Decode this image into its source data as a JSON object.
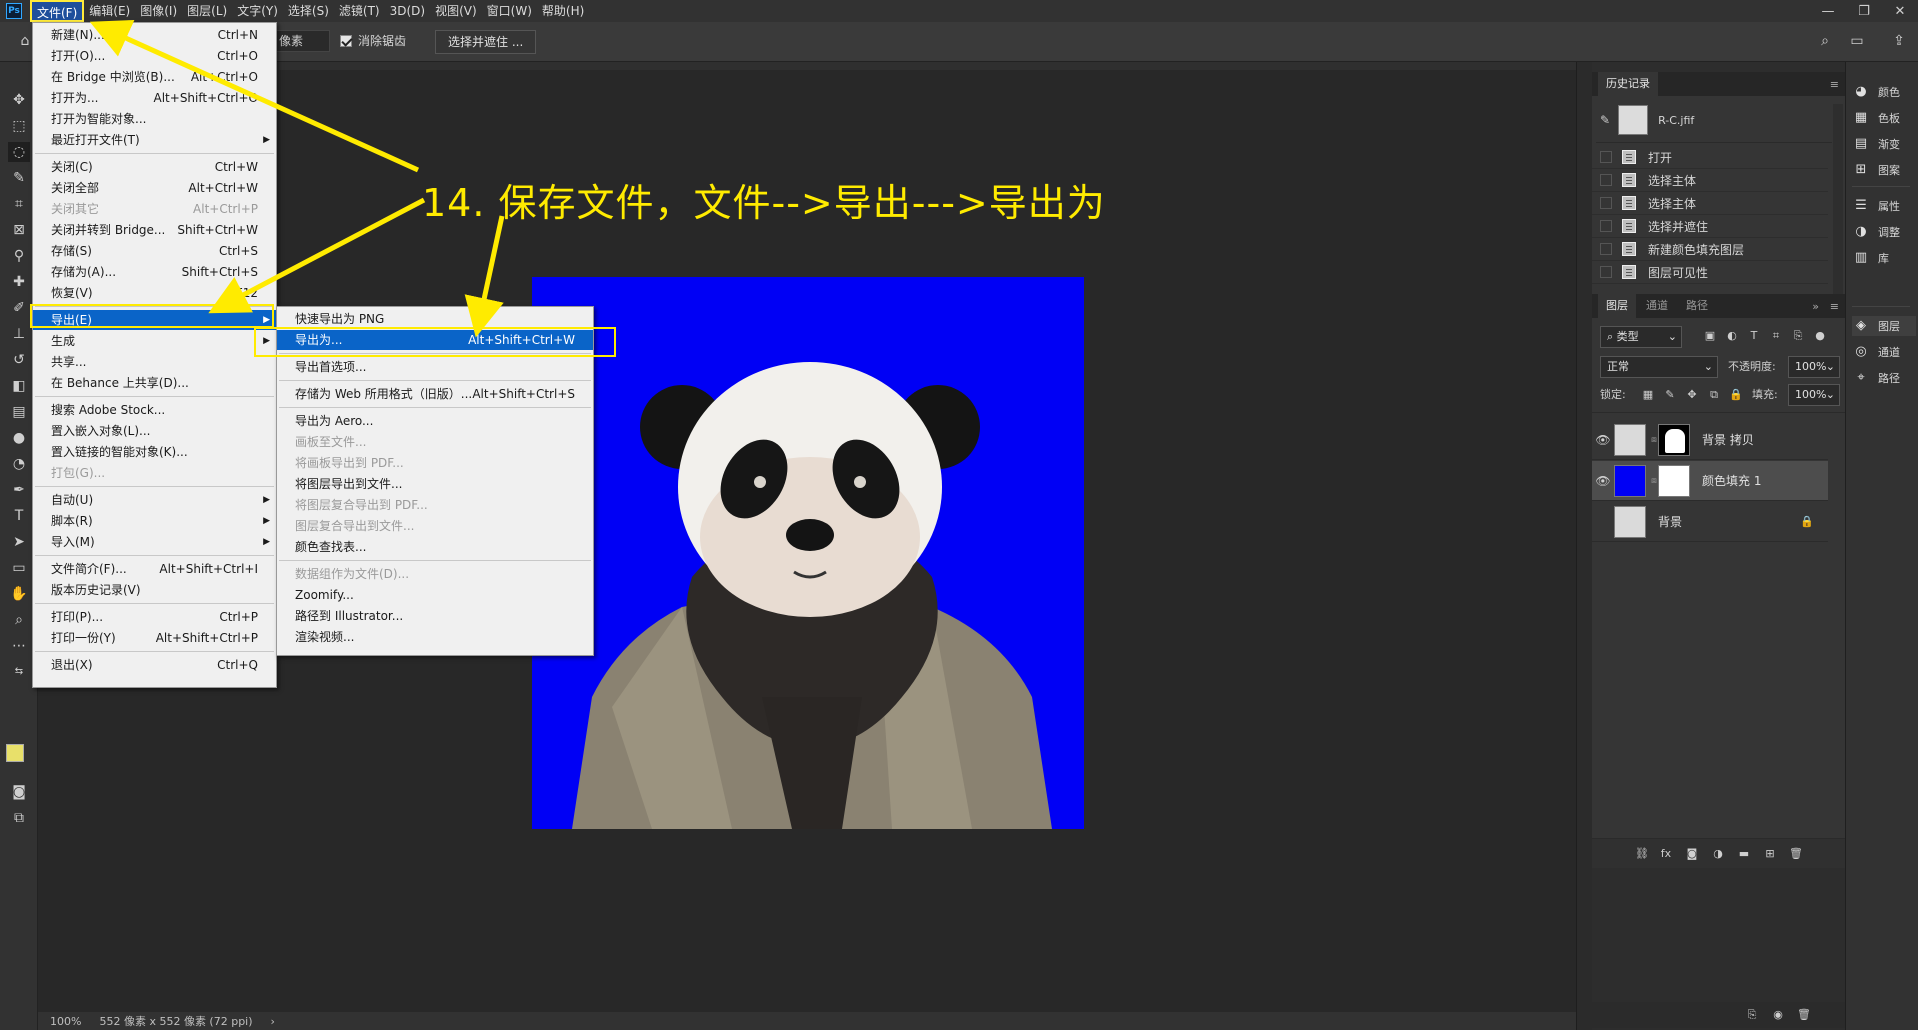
{
  "app": {
    "logo": "Ps"
  },
  "menubar": {
    "items": [
      "文件(F)",
      "编辑(E)",
      "图像(I)",
      "图层(L)",
      "文字(Y)",
      "选择(S)",
      "滤镜(T)",
      "3D(D)",
      "视图(V)",
      "窗口(W)",
      "帮助(H)"
    ],
    "window_controls": [
      "—",
      "❐",
      "✕"
    ]
  },
  "options": {
    "feather_unit": "像素",
    "antialias_label": "消除锯齿",
    "select_mask_button": "选择并遮住 ..."
  },
  "file_menu": {
    "items": [
      {
        "label": "新建(N)...",
        "shortcut": "Ctrl+N"
      },
      {
        "label": "打开(O)...",
        "shortcut": "Ctrl+O"
      },
      {
        "label": "在 Bridge 中浏览(B)...",
        "shortcut": "Alt+Ctrl+O"
      },
      {
        "label": "打开为...",
        "shortcut": "Alt+Shift+Ctrl+O"
      },
      {
        "label": "打开为智能对象...",
        "shortcut": ""
      },
      {
        "label": "最近打开文件(T)",
        "shortcut": ""
      },
      {
        "label": "关闭(C)",
        "shortcut": "Ctrl+W"
      },
      {
        "label": "关闭全部",
        "shortcut": "Alt+Ctrl+W"
      },
      {
        "label": "关闭其它",
        "shortcut": "Alt+Ctrl+P"
      },
      {
        "label": "关闭并转到 Bridge...",
        "shortcut": "Shift+Ctrl+W"
      },
      {
        "label": "存储(S)",
        "shortcut": "Ctrl+S"
      },
      {
        "label": "存储为(A)...",
        "shortcut": "Shift+Ctrl+S"
      },
      {
        "label": "恢复(V)",
        "shortcut": "F12"
      },
      {
        "label": "导出(E)",
        "shortcut": ""
      },
      {
        "label": "生成",
        "shortcut": ""
      },
      {
        "label": "共享...",
        "shortcut": ""
      },
      {
        "label": "在 Behance 上共享(D)...",
        "shortcut": ""
      },
      {
        "label": "搜索 Adobe Stock...",
        "shortcut": ""
      },
      {
        "label": "置入嵌入对象(L)...",
        "shortcut": ""
      },
      {
        "label": "置入链接的智能对象(K)...",
        "shortcut": ""
      },
      {
        "label": "打包(G)...",
        "shortcut": ""
      },
      {
        "label": "自动(U)",
        "shortcut": ""
      },
      {
        "label": "脚本(R)",
        "shortcut": ""
      },
      {
        "label": "导入(M)",
        "shortcut": ""
      },
      {
        "label": "文件简介(F)...",
        "shortcut": "Alt+Shift+Ctrl+I"
      },
      {
        "label": "版本历史记录(V)",
        "shortcut": ""
      },
      {
        "label": "打印(P)...",
        "shortcut": "Ctrl+P"
      },
      {
        "label": "打印一份(Y)",
        "shortcut": "Alt+Shift+Ctrl+P"
      },
      {
        "label": "退出(X)",
        "shortcut": "Ctrl+Q"
      }
    ]
  },
  "export_submenu": {
    "items": [
      {
        "label": "快速导出为 PNG",
        "shortcut": ""
      },
      {
        "label": "导出为...",
        "shortcut": "Alt+Shift+Ctrl+W"
      },
      {
        "label": "导出首选项...",
        "shortcut": ""
      },
      {
        "label": "存储为 Web 所用格式（旧版）...",
        "shortcut": "Alt+Shift+Ctrl+S"
      },
      {
        "label": "导出为 Aero...",
        "shortcut": ""
      },
      {
        "label": "画板至文件...",
        "shortcut": ""
      },
      {
        "label": "将画板导出到 PDF...",
        "shortcut": ""
      },
      {
        "label": "将图层导出到文件...",
        "shortcut": ""
      },
      {
        "label": "将图层复合导出到 PDF...",
        "shortcut": ""
      },
      {
        "label": "图层复合导出到文件...",
        "shortcut": ""
      },
      {
        "label": "颜色查找表...",
        "shortcut": ""
      },
      {
        "label": "数据组作为文件(D)...",
        "shortcut": ""
      },
      {
        "label": "Zoomify...",
        "shortcut": ""
      },
      {
        "label": "路径到 Illustrator...",
        "shortcut": ""
      },
      {
        "label": "渲染视频...",
        "shortcut": ""
      }
    ]
  },
  "annotation": {
    "text": "14. 保存文件，文件-->导出--->导出为"
  },
  "history_panel": {
    "title": "历史记录",
    "snapshot": "R-C.jfif",
    "steps": [
      "打开",
      "选择主体",
      "选择主体",
      "选择并遮住",
      "新建颜色填充图层",
      "图层可见性"
    ]
  },
  "layers_panel": {
    "tabs": [
      "图层",
      "通道",
      "路径"
    ],
    "filter_label": "类型",
    "blend_mode": "正常",
    "opacity_label": "不透明度:",
    "opacity_value": "100%",
    "lock_label": "锁定:",
    "fill_label": "填充:",
    "fill_value": "100%",
    "layers": [
      {
        "name": "背景 拷贝"
      },
      {
        "name": "颜色填充 1"
      },
      {
        "name": "背景"
      }
    ]
  },
  "dock": {
    "items": [
      "颜色",
      "色板",
      "渐变",
      "图案",
      "属性",
      "调整",
      "库",
      "图层",
      "通道",
      "路径"
    ]
  },
  "status": {
    "zoom": "100%",
    "doc_info": "552 像素 x 552 像素 (72 ppi)"
  },
  "colors": {
    "canvas_bg": "#0000f5",
    "highlight": "#0a64c8",
    "annotation": "#ffeb00"
  }
}
